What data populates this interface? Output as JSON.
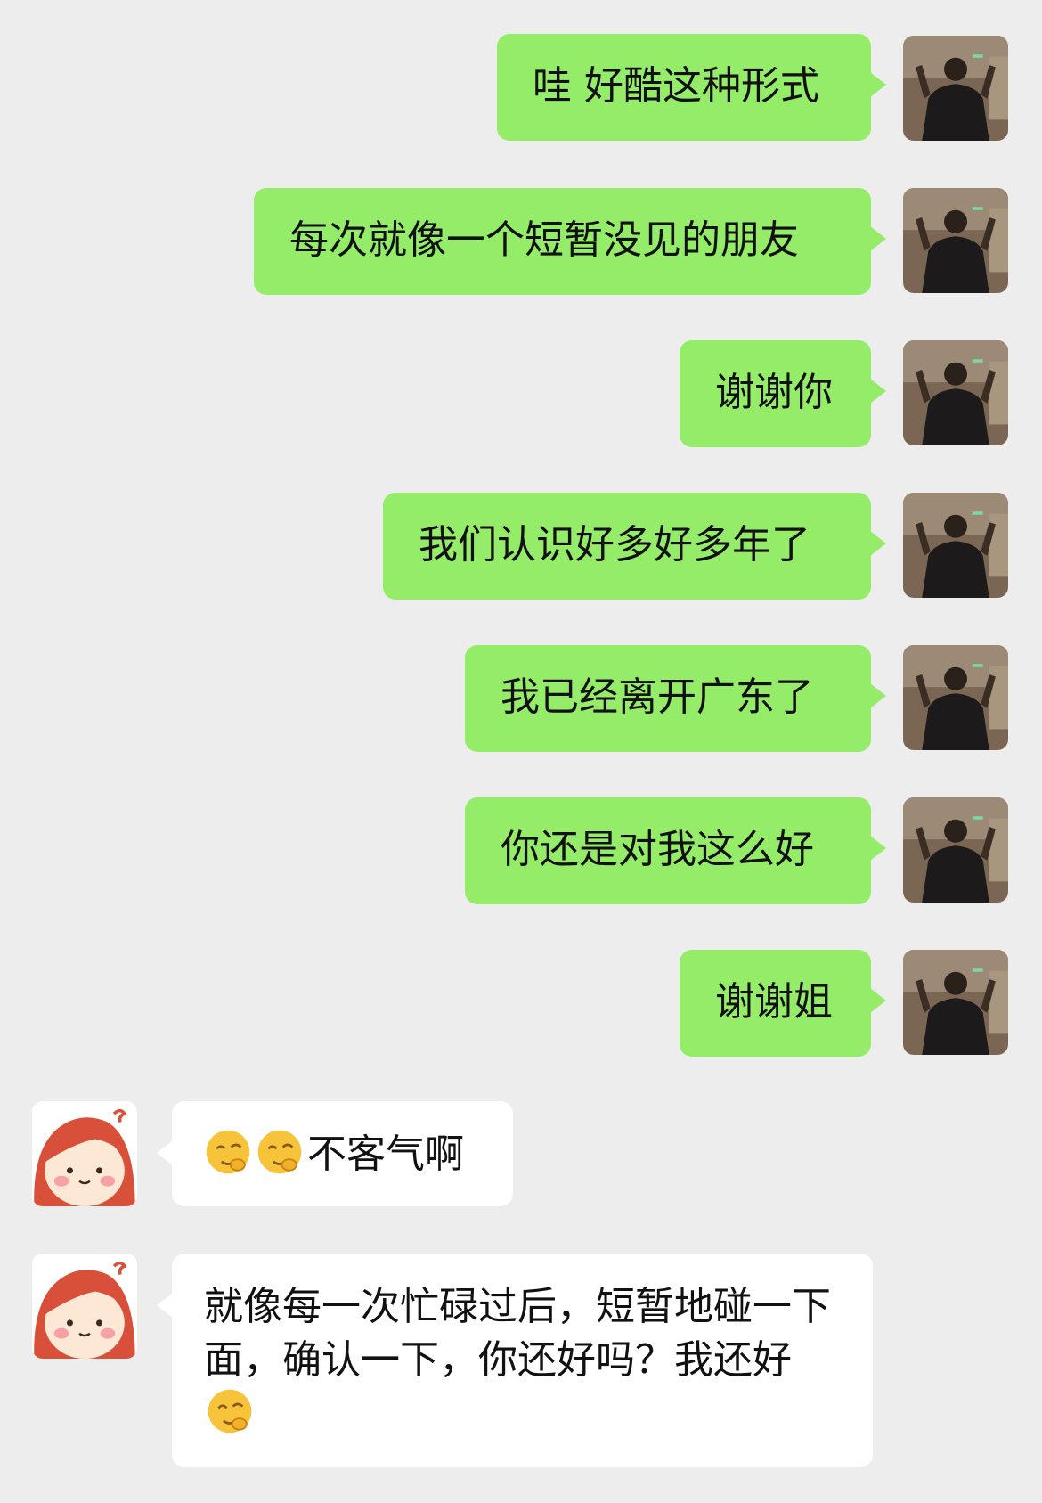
{
  "messages": [
    {
      "side": "sent",
      "text": "哇 好酷这种形式"
    },
    {
      "side": "sent",
      "text": "每次就像一个短暂没见的朋友"
    },
    {
      "side": "sent",
      "text": "谢谢你"
    },
    {
      "side": "sent",
      "text": "我们认识好多好多年了"
    },
    {
      "side": "sent",
      "text": "我已经离开广东了"
    },
    {
      "side": "sent",
      "text": "你还是对我这么好"
    },
    {
      "side": "sent",
      "text": "谢谢姐"
    },
    {
      "side": "recv",
      "emoji": "hehe-emoji",
      "text": "不客气啊"
    },
    {
      "side": "recv",
      "text": "就像每一次忙碌过后，短暂地碰一下面，确认一下，你还好吗？我还好",
      "emoji_after": "hehe-emoji"
    }
  ],
  "colors": {
    "background": "#ededed",
    "sent_bubble": "#95ec69",
    "recv_bubble": "#ffffff"
  }
}
